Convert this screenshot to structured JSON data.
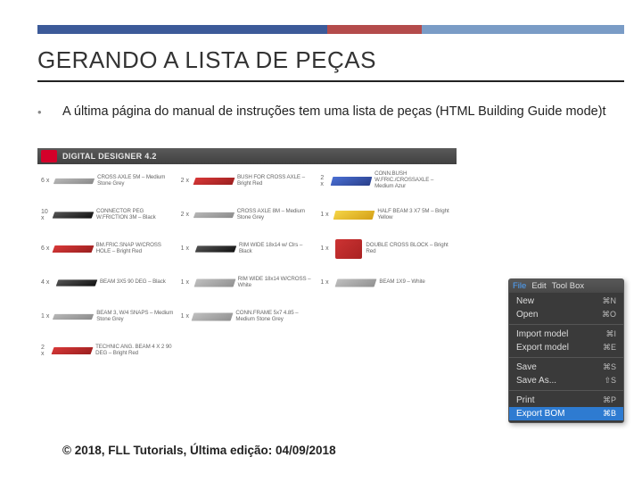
{
  "title": "GERANDO A LISTA DE PEÇAS",
  "body": "A última página do manual de instruções tem uma lista de peças (HTML Building Guide mode)t",
  "ldd_header": "DIGITAL DESIGNER 4.2",
  "parts": [
    {
      "qty": "6 x",
      "name": "CROSS AXLE 5M – Medium Stone Grey",
      "c": "gray"
    },
    {
      "qty": "2 x",
      "name": "BUSH FOR CROSS AXLE – Bright Red",
      "c": "red"
    },
    {
      "qty": "2 x",
      "name": "CONN.BUSH W.FRIC./CROSSAXLE – Medium Azur",
      "c": "blue"
    },
    {
      "qty": "10 x",
      "name": "CONNECTOR PEG W.FRICTION 3M – Black",
      "c": "black"
    },
    {
      "qty": "2 x",
      "name": "CROSS AXLE 8M – Medium Stone Grey",
      "c": "gray"
    },
    {
      "qty": "1 x",
      "name": "HALF BEAM 3 X7 5M – Bright Yellow",
      "c": "yellow"
    },
    {
      "qty": "6 x",
      "name": "BM.FRIC.SNAP W/CROSS HOLE – Bright Red",
      "c": "red"
    },
    {
      "qty": "1 x",
      "name": "RIM WIDE 18x14 w/ Clrs – Black",
      "c": "black"
    },
    {
      "qty": "1 x",
      "name": "DOUBLE CROSS BLOCK – Bright Red",
      "c": "redbl"
    },
    {
      "qty": "4 x",
      "name": "BEAM 3X5 90 DEG – Black",
      "c": "black"
    },
    {
      "qty": "1 x",
      "name": "RIM WIDE 18x14 W/CROSS – White",
      "c": "gray2"
    },
    {
      "qty": "1 x",
      "name": "BEAM 1X9 – White",
      "c": "gray2"
    },
    {
      "qty": "1 x",
      "name": "BEAM 3, W/4 SNAPS – Medium Stone Grey",
      "c": "gray"
    },
    {
      "qty": "1 x",
      "name": "CONN.FRAME 5x7 4.85 – Medium Stone Grey",
      "c": "gray2"
    },
    {
      "qty": "",
      "name": "",
      "c": ""
    },
    {
      "qty": "2 x",
      "name": "TECHNIC ANG. BEAM 4 X 2 90 DEG – Bright Red",
      "c": "red"
    },
    {
      "qty": "",
      "name": "",
      "c": ""
    },
    {
      "qty": "",
      "name": "",
      "c": ""
    }
  ],
  "menu": {
    "tabs": [
      "File",
      "Edit",
      "Tool Box"
    ],
    "groups": [
      [
        {
          "label": "New",
          "key": "⌘N"
        },
        {
          "label": "Open",
          "key": "⌘O"
        }
      ],
      [
        {
          "label": "Import model",
          "key": "⌘I"
        },
        {
          "label": "Export model",
          "key": "⌘E"
        }
      ],
      [
        {
          "label": "Save",
          "key": "⌘S"
        },
        {
          "label": "Save As...",
          "key": "⇧S"
        }
      ],
      [
        {
          "label": "Print",
          "key": "⌘P"
        },
        {
          "label": "Export BOM",
          "key": "⌘B",
          "hl": true
        }
      ]
    ]
  },
  "footer": "© 2018, FLL Tutorials, Última edição: 04/09/2018"
}
